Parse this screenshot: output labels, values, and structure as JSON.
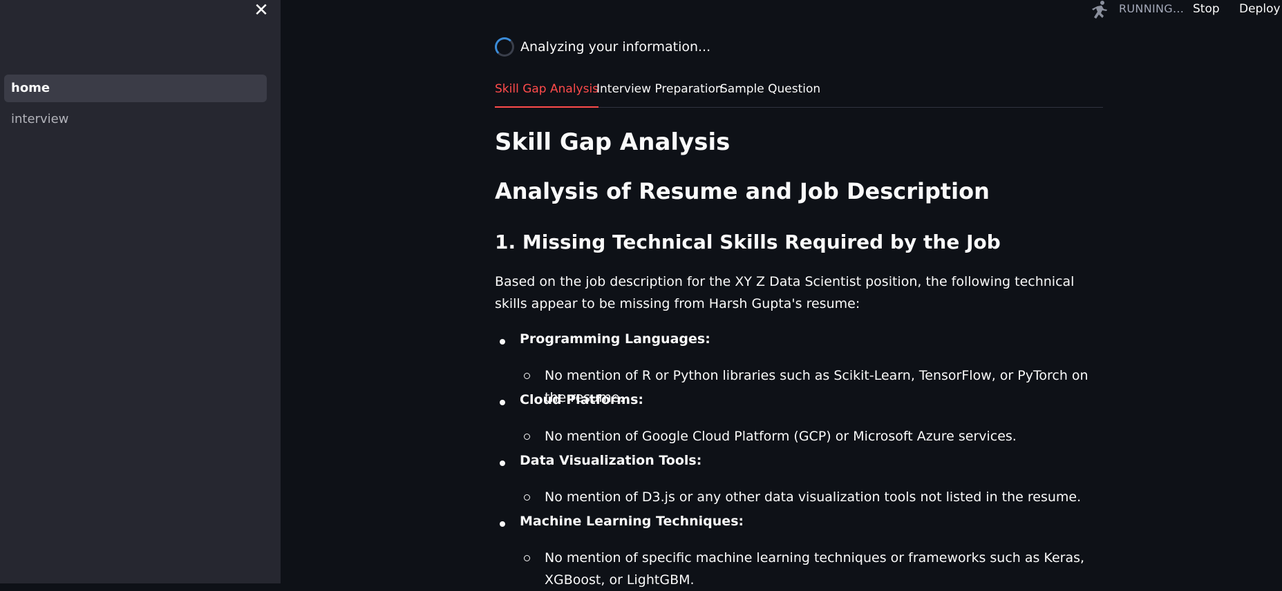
{
  "sidebar": {
    "close_label": "✕",
    "items": [
      {
        "label": "home",
        "active": true
      },
      {
        "label": "interview",
        "active": false
      }
    ]
  },
  "topbar": {
    "running_label": "RUNNING...",
    "stop_label": "Stop",
    "deploy_label": "Deploy"
  },
  "status": {
    "text": "Analyzing your information..."
  },
  "tabs": [
    {
      "label": "Skill Gap Analysis",
      "active": true
    },
    {
      "label": "Interview Preparation",
      "active": false
    },
    {
      "label": "Sample Question",
      "active": false
    }
  ],
  "content": {
    "title": "Skill Gap Analysis",
    "subtitle": "Analysis of Resume and Job Description",
    "section_heading": "1. Missing Technical Skills Required by the Job",
    "intro": "Based on the job description for the XY Z Data Scientist position, the following technical skills appear to be missing from Harsh Gupta's resume:",
    "bullets": [
      {
        "label": "Programming Languages:",
        "detail": "No mention of R or Python libraries such as Scikit-Learn, TensorFlow, or PyTorch on the resume."
      },
      {
        "label": "Cloud Platforms:",
        "detail": "No mention of Google Cloud Platform (GCP) or Microsoft Azure services."
      },
      {
        "label": "Data Visualization Tools:",
        "detail": "No mention of D3.js or any other data visualization tools not listed in the resume."
      },
      {
        "label": "Machine Learning Techniques:",
        "detail": "No mention of specific machine learning techniques or frameworks such as Keras, XGBoost, or LightGBM."
      }
    ]
  },
  "colors": {
    "accent": "#ff4b4b",
    "sidebar_bg": "#262730",
    "main_bg": "#0e1117",
    "spinner": "#3b8cd9"
  },
  "icons": {
    "close": "close-icon",
    "running": "running-figure-icon",
    "spinner": "spinner-icon"
  }
}
